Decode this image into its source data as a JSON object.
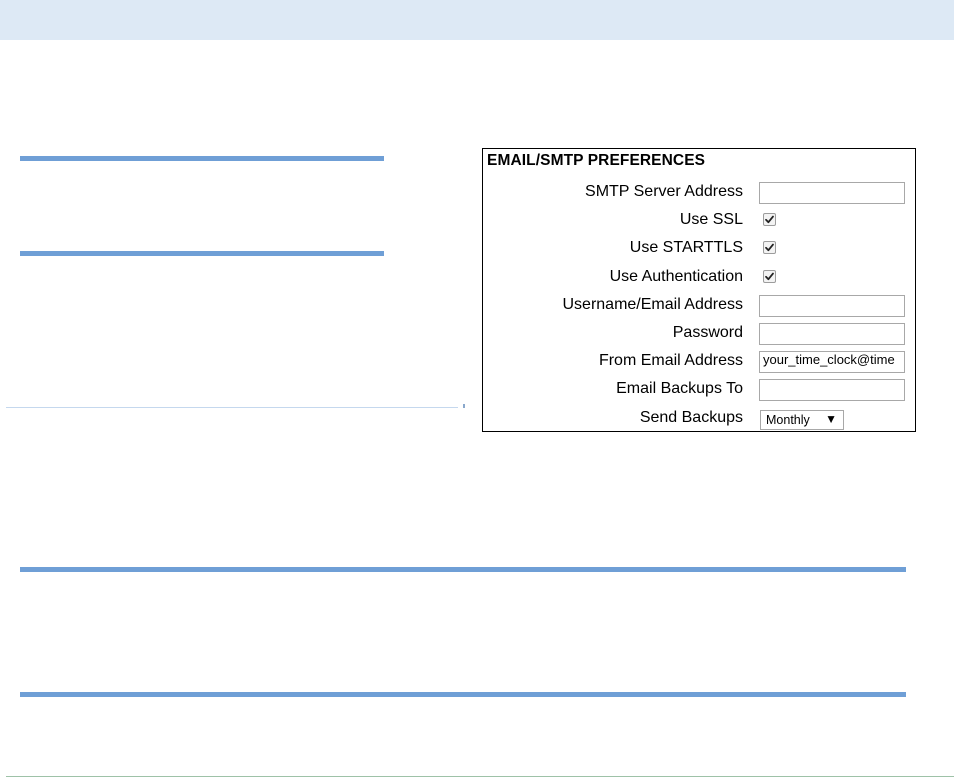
{
  "panel": {
    "title": "EMAIL/SMTP PREFERENCES",
    "fields": [
      {
        "label": "SMTP Server Address",
        "type": "text",
        "value": ""
      },
      {
        "label": "Use SSL",
        "type": "checkbox",
        "checked": true
      },
      {
        "label": "Use STARTTLS",
        "type": "checkbox",
        "checked": true
      },
      {
        "label": "Use Authentication",
        "type": "checkbox",
        "checked": true
      },
      {
        "label": "Username/Email Address",
        "type": "text",
        "value": ""
      },
      {
        "label": "Password",
        "type": "text",
        "value": ""
      },
      {
        "label": "From Email Address",
        "type": "text",
        "value": "your_time_clock@time"
      },
      {
        "label": "Email Backups To",
        "type": "text",
        "value": ""
      },
      {
        "label": "Send Backups",
        "type": "select",
        "value": "Monthly"
      }
    ]
  },
  "icons": {
    "checkmark": "check-icon",
    "dropdown": "triangle-down-icon"
  },
  "colors": {
    "top_bar": "#dde9f5",
    "rule_blue": "#6f9fd6"
  }
}
